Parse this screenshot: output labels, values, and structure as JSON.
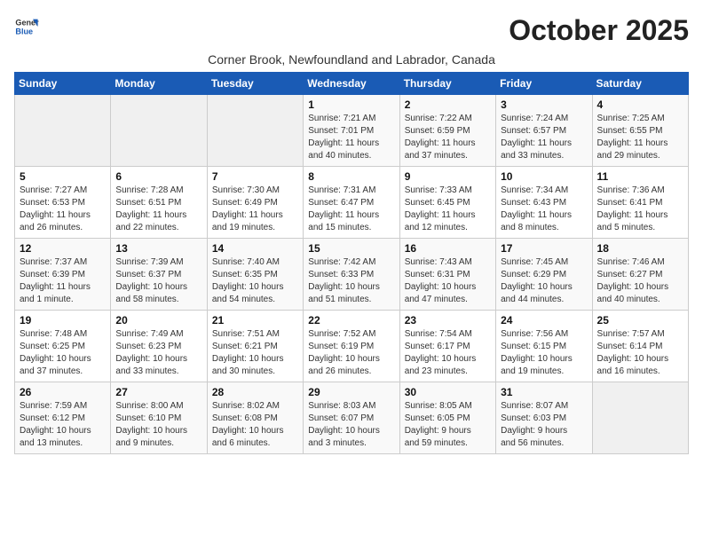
{
  "header": {
    "logo_line1": "General",
    "logo_line2": "Blue",
    "month": "October 2025",
    "location": "Corner Brook, Newfoundland and Labrador, Canada"
  },
  "weekdays": [
    "Sunday",
    "Monday",
    "Tuesday",
    "Wednesday",
    "Thursday",
    "Friday",
    "Saturday"
  ],
  "weeks": [
    [
      {
        "day": "",
        "info": ""
      },
      {
        "day": "",
        "info": ""
      },
      {
        "day": "",
        "info": ""
      },
      {
        "day": "1",
        "info": "Sunrise: 7:21 AM\nSunset: 7:01 PM\nDaylight: 11 hours\nand 40 minutes."
      },
      {
        "day": "2",
        "info": "Sunrise: 7:22 AM\nSunset: 6:59 PM\nDaylight: 11 hours\nand 37 minutes."
      },
      {
        "day": "3",
        "info": "Sunrise: 7:24 AM\nSunset: 6:57 PM\nDaylight: 11 hours\nand 33 minutes."
      },
      {
        "day": "4",
        "info": "Sunrise: 7:25 AM\nSunset: 6:55 PM\nDaylight: 11 hours\nand 29 minutes."
      }
    ],
    [
      {
        "day": "5",
        "info": "Sunrise: 7:27 AM\nSunset: 6:53 PM\nDaylight: 11 hours\nand 26 minutes."
      },
      {
        "day": "6",
        "info": "Sunrise: 7:28 AM\nSunset: 6:51 PM\nDaylight: 11 hours\nand 22 minutes."
      },
      {
        "day": "7",
        "info": "Sunrise: 7:30 AM\nSunset: 6:49 PM\nDaylight: 11 hours\nand 19 minutes."
      },
      {
        "day": "8",
        "info": "Sunrise: 7:31 AM\nSunset: 6:47 PM\nDaylight: 11 hours\nand 15 minutes."
      },
      {
        "day": "9",
        "info": "Sunrise: 7:33 AM\nSunset: 6:45 PM\nDaylight: 11 hours\nand 12 minutes."
      },
      {
        "day": "10",
        "info": "Sunrise: 7:34 AM\nSunset: 6:43 PM\nDaylight: 11 hours\nand 8 minutes."
      },
      {
        "day": "11",
        "info": "Sunrise: 7:36 AM\nSunset: 6:41 PM\nDaylight: 11 hours\nand 5 minutes."
      }
    ],
    [
      {
        "day": "12",
        "info": "Sunrise: 7:37 AM\nSunset: 6:39 PM\nDaylight: 11 hours\nand 1 minute."
      },
      {
        "day": "13",
        "info": "Sunrise: 7:39 AM\nSunset: 6:37 PM\nDaylight: 10 hours\nand 58 minutes."
      },
      {
        "day": "14",
        "info": "Sunrise: 7:40 AM\nSunset: 6:35 PM\nDaylight: 10 hours\nand 54 minutes."
      },
      {
        "day": "15",
        "info": "Sunrise: 7:42 AM\nSunset: 6:33 PM\nDaylight: 10 hours\nand 51 minutes."
      },
      {
        "day": "16",
        "info": "Sunrise: 7:43 AM\nSunset: 6:31 PM\nDaylight: 10 hours\nand 47 minutes."
      },
      {
        "day": "17",
        "info": "Sunrise: 7:45 AM\nSunset: 6:29 PM\nDaylight: 10 hours\nand 44 minutes."
      },
      {
        "day": "18",
        "info": "Sunrise: 7:46 AM\nSunset: 6:27 PM\nDaylight: 10 hours\nand 40 minutes."
      }
    ],
    [
      {
        "day": "19",
        "info": "Sunrise: 7:48 AM\nSunset: 6:25 PM\nDaylight: 10 hours\nand 37 minutes."
      },
      {
        "day": "20",
        "info": "Sunrise: 7:49 AM\nSunset: 6:23 PM\nDaylight: 10 hours\nand 33 minutes."
      },
      {
        "day": "21",
        "info": "Sunrise: 7:51 AM\nSunset: 6:21 PM\nDaylight: 10 hours\nand 30 minutes."
      },
      {
        "day": "22",
        "info": "Sunrise: 7:52 AM\nSunset: 6:19 PM\nDaylight: 10 hours\nand 26 minutes."
      },
      {
        "day": "23",
        "info": "Sunrise: 7:54 AM\nSunset: 6:17 PM\nDaylight: 10 hours\nand 23 minutes."
      },
      {
        "day": "24",
        "info": "Sunrise: 7:56 AM\nSunset: 6:15 PM\nDaylight: 10 hours\nand 19 minutes."
      },
      {
        "day": "25",
        "info": "Sunrise: 7:57 AM\nSunset: 6:14 PM\nDaylight: 10 hours\nand 16 minutes."
      }
    ],
    [
      {
        "day": "26",
        "info": "Sunrise: 7:59 AM\nSunset: 6:12 PM\nDaylight: 10 hours\nand 13 minutes."
      },
      {
        "day": "27",
        "info": "Sunrise: 8:00 AM\nSunset: 6:10 PM\nDaylight: 10 hours\nand 9 minutes."
      },
      {
        "day": "28",
        "info": "Sunrise: 8:02 AM\nSunset: 6:08 PM\nDaylight: 10 hours\nand 6 minutes."
      },
      {
        "day": "29",
        "info": "Sunrise: 8:03 AM\nSunset: 6:07 PM\nDaylight: 10 hours\nand 3 minutes."
      },
      {
        "day": "30",
        "info": "Sunrise: 8:05 AM\nSunset: 6:05 PM\nDaylight: 9 hours\nand 59 minutes."
      },
      {
        "day": "31",
        "info": "Sunrise: 8:07 AM\nSunset: 6:03 PM\nDaylight: 9 hours\nand 56 minutes."
      },
      {
        "day": "",
        "info": ""
      }
    ]
  ]
}
